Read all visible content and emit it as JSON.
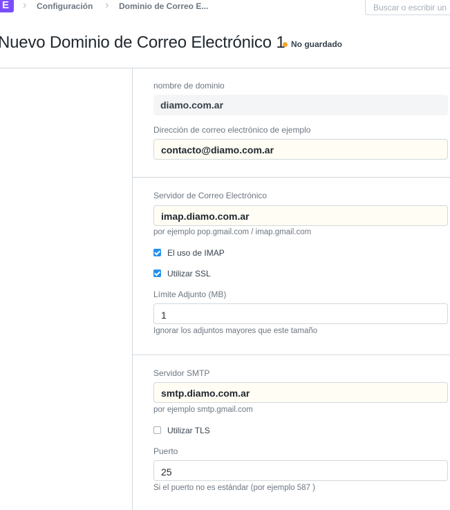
{
  "navbar": {
    "logo_letter": "E",
    "breadcrumbs": [
      "Configuración",
      "Dominio de Correo E..."
    ],
    "search_placeholder": "Buscar o escribir un"
  },
  "header": {
    "title": "Nuevo Dominio de Correo Electrónico 1",
    "status": "No guardado",
    "status_color": "#f8a426"
  },
  "form": {
    "domain_name": {
      "label": "nombre de dominio",
      "value": "diamo.com.ar"
    },
    "example_email": {
      "label": "Dirección de correo electrónico de ejemplo",
      "value": "contacto@diamo.com.ar"
    },
    "email_server": {
      "label": "Servidor de Correo Electrónico",
      "value": "imap.diamo.com.ar",
      "help": "por ejemplo pop.gmail.com / imap.gmail.com"
    },
    "use_imap": {
      "label": "El uso de IMAP",
      "checked": true
    },
    "use_ssl": {
      "label": "Utilizar SSL",
      "checked": true
    },
    "attachment_limit": {
      "label": "Límite Adjunto (MB)",
      "value": "1",
      "help": "Ignorar los adjuntos mayores que este tamaño"
    },
    "smtp_server": {
      "label": "Servidor SMTP",
      "value": "smtp.diamo.com.ar",
      "help": "por ejemplo smtp.gmail.com"
    },
    "use_tls": {
      "label": "Utilizar TLS",
      "checked": false
    },
    "port": {
      "label": "Puerto",
      "value": "25",
      "help": "Si el puerto no es estándar (por ejemplo 587 )"
    }
  },
  "colors": {
    "accent": "#2490ef",
    "brand": "#7c4dff"
  }
}
